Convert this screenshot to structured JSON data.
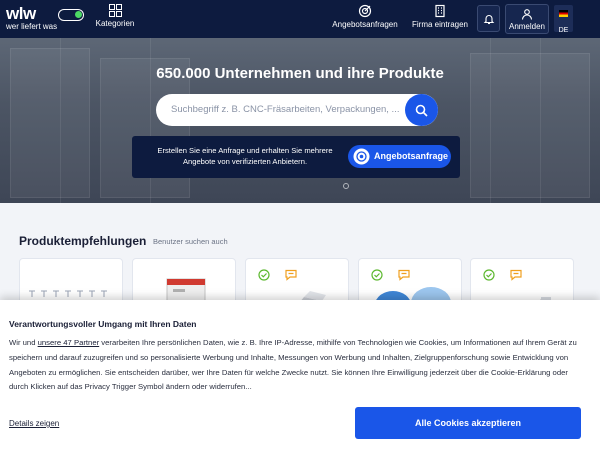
{
  "header": {
    "logo_text": "wlw",
    "logo_sub": "wer liefert was",
    "categories_label": "Kategorien",
    "requests_label": "Angebotsanfragen",
    "register_label": "Firma eintragen",
    "login_label": "Anmelden",
    "lang_code": "DE"
  },
  "hero": {
    "title": "650.000 Unternehmen und ihre Produkte",
    "search_placeholder": "Suchbegriff z. B. CNC-Fräsarbeiten, Verpackungen, ...",
    "promo_text": "Erstellen Sie eine Anfrage und erhalten Sie mehrere Angebote von verifizierten Anbietern.",
    "promo_button": "Angebotsanfrage"
  },
  "recommendations": {
    "title": "Produktempfehlungen",
    "subtitle": "Benutzer suchen auch"
  },
  "cookie": {
    "title": "Verantwortungsvoller Umgang mit Ihren Daten",
    "text_before_link": "Wir und ",
    "partner_link": "unsere 47 Partner",
    "text_after_link": " verarbeiten Ihre persönlichen Daten, wie z. B. Ihre IP-Adresse, mithilfe von Technologien wie Cookies, um Informationen auf Ihrem Gerät zu speichern und darauf zuzugreifen und so personalisierte Werbung und Inhalte, Messungen von Werbung und Inhalten, Zielgruppenforschung sowie Entwicklung von Angeboten zu ermöglichen. Sie entscheiden darüber, wer Ihre Daten für welche Zwecke nutzt. Sie können Ihre Einwilligung jederzeit über die Cookie-Erklärung oder durch Klicken auf das Privacy Trigger Symbol ändern oder widerrufen...",
    "details_label": "Details zeigen",
    "accept_label": "Alle Cookies akzeptieren"
  },
  "colors": {
    "header_bg": "#0d1b3f",
    "accent": "#1a56e8",
    "verified_green": "#5cb82e",
    "quote_orange": "#f0a020"
  }
}
